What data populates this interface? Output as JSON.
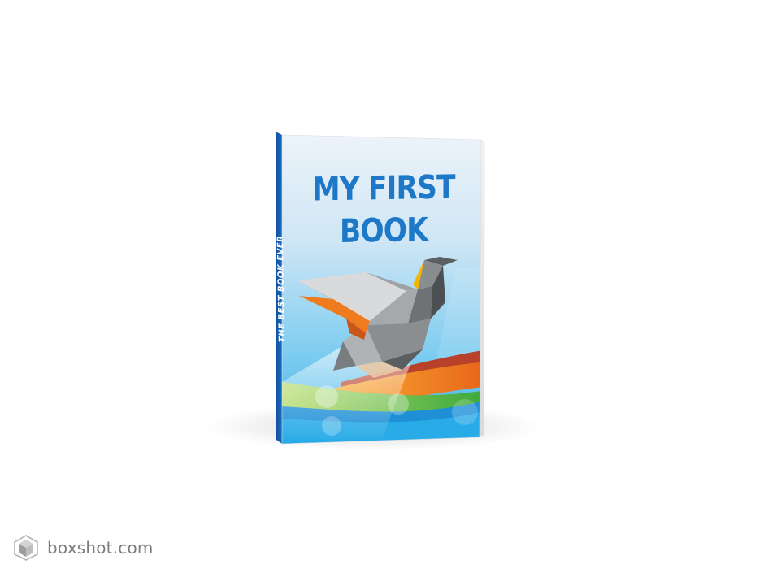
{
  "book": {
    "title_line_1": "MY FIRST",
    "title_line_2": "BOOK",
    "spine_text": "THE BEST BOOK EVER"
  },
  "watermark": {
    "text": "boxshot.com",
    "icon": "cube-icon"
  },
  "colors": {
    "title": "#1d78c8",
    "spine": "#1764b8",
    "sky_top": "#e6f0f8",
    "sky_bottom": "#42b7ec",
    "orange_wave": "#f07a1e",
    "green_wave": "#7dc241",
    "red_wave": "#b8412a",
    "bird_gray": "#7f8285",
    "watermark": "#7d7d7d"
  }
}
